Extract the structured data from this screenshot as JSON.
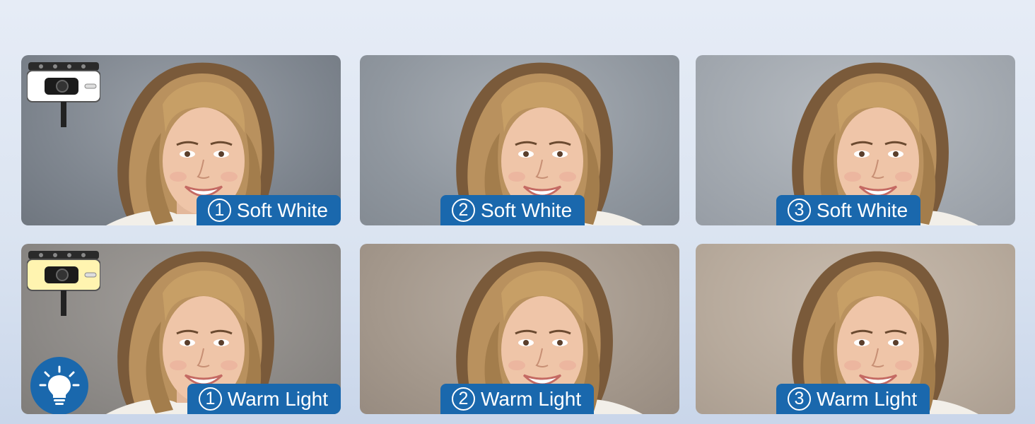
{
  "tiles": {
    "soft": [
      {
        "num": "1",
        "label": "Soft White"
      },
      {
        "num": "2",
        "label": "Soft White"
      },
      {
        "num": "3",
        "label": "Soft White"
      }
    ],
    "warm": [
      {
        "num": "1",
        "label": "Warm Light"
      },
      {
        "num": "2",
        "label": "Warm Light"
      },
      {
        "num": "3",
        "label": "Warm Light"
      }
    ]
  },
  "colors": {
    "label_bg": "#1a68ad",
    "soft_light_panel": "#ffffff",
    "warm_light_panel": "#fff4b0"
  },
  "icons": [
    "webcam-light-device-icon",
    "light-bulb-icon"
  ]
}
